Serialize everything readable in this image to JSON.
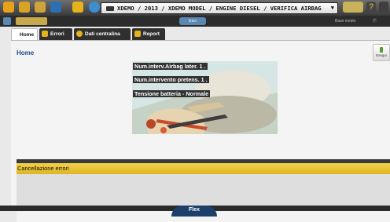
{
  "breadcrumb": "XDEMO / 2013 / XDEMO MODEL / ENGINE DIESEL / VERIFICA AIRBAG",
  "toolbar2": {
    "center_label": "Esci",
    "right1_label": "Base medio",
    "right2_label": "Ⓟ"
  },
  "tabs": [
    {
      "label": "Home",
      "active": true
    },
    {
      "label": "Errori",
      "icon": "warning-icon",
      "icon_color": "#e5b21b"
    },
    {
      "label": "Dati centralina",
      "icon": "gear-icon",
      "icon_color": "#e5b21b"
    },
    {
      "label": "Report",
      "icon": "document-icon",
      "icon_color": "#e5b21b"
    }
  ],
  "page": {
    "title": "Home",
    "esegui_label": "Esegui"
  },
  "panel": {
    "labels": [
      "Num.interv.Airbag later.  1 .",
      "Num.intervento pretens.  1 .",
      "Tensione batteria - Normale"
    ]
  },
  "section": {
    "yellow_text": "Cancellazione errori"
  },
  "footer": {
    "brand": "Flex"
  },
  "colors": {
    "accent": "#e5b21b",
    "dark": "#303030",
    "title_blue": "#1f4d8a"
  }
}
